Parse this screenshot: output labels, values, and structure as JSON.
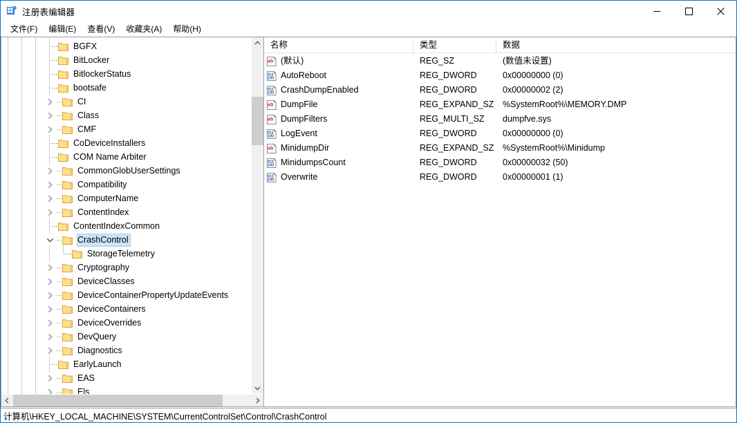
{
  "window": {
    "title": "注册表编辑器",
    "icon": "regedit-icon",
    "border_color": "#0078d7",
    "controls": [
      {
        "name": "minimize-button",
        "glyph": "minimize-icon"
      },
      {
        "name": "maximize-button",
        "glyph": "maximize-icon"
      },
      {
        "name": "close-button",
        "glyph": "close-icon"
      }
    ]
  },
  "menubar": {
    "items": [
      {
        "label": "文件(F)"
      },
      {
        "label": "编辑(E)"
      },
      {
        "label": "查看(V)"
      },
      {
        "label": "收藏夹(A)"
      },
      {
        "label": "帮助(H)"
      }
    ]
  },
  "tree": {
    "selected_key": "CrashControl",
    "selection_color": "#cce4f7",
    "folder_color": "#ffd966",
    "nodes": [
      {
        "label": "BGFX",
        "depth": 0,
        "expander": "none",
        "connector": "tee"
      },
      {
        "label": "BitLocker",
        "depth": 0,
        "expander": "none",
        "connector": "tee"
      },
      {
        "label": "BitlockerStatus",
        "depth": 0,
        "expander": "none",
        "connector": "tee"
      },
      {
        "label": "bootsafe",
        "depth": 0,
        "expander": "none",
        "connector": "tee"
      },
      {
        "label": "CI",
        "depth": 0,
        "expander": "collapsed",
        "connector": "tee"
      },
      {
        "label": "Class",
        "depth": 0,
        "expander": "collapsed",
        "connector": "tee"
      },
      {
        "label": "CMF",
        "depth": 0,
        "expander": "collapsed",
        "connector": "tee"
      },
      {
        "label": "CoDeviceInstallers",
        "depth": 0,
        "expander": "none",
        "connector": "tee"
      },
      {
        "label": "COM Name Arbiter",
        "depth": 0,
        "expander": "none",
        "connector": "tee"
      },
      {
        "label": "CommonGlobUserSettings",
        "depth": 0,
        "expander": "collapsed",
        "connector": "tee"
      },
      {
        "label": "Compatibility",
        "depth": 0,
        "expander": "collapsed",
        "connector": "tee"
      },
      {
        "label": "ComputerName",
        "depth": 0,
        "expander": "collapsed",
        "connector": "tee"
      },
      {
        "label": "ContentIndex",
        "depth": 0,
        "expander": "collapsed",
        "connector": "tee"
      },
      {
        "label": "ContentIndexCommon",
        "depth": 0,
        "expander": "none",
        "connector": "tee"
      },
      {
        "label": "CrashControl",
        "depth": 0,
        "expander": "expanded",
        "connector": "tee",
        "selected": true
      },
      {
        "label": "StorageTelemetry",
        "depth": 1,
        "expander": "none",
        "connector": "last"
      },
      {
        "label": "Cryptography",
        "depth": 0,
        "expander": "collapsed",
        "connector": "tee"
      },
      {
        "label": "DeviceClasses",
        "depth": 0,
        "expander": "collapsed",
        "connector": "tee"
      },
      {
        "label": "DeviceContainerPropertyUpdateEvents",
        "depth": 0,
        "expander": "collapsed",
        "connector": "tee"
      },
      {
        "label": "DeviceContainers",
        "depth": 0,
        "expander": "collapsed",
        "connector": "tee"
      },
      {
        "label": "DeviceOverrides",
        "depth": 0,
        "expander": "collapsed",
        "connector": "tee"
      },
      {
        "label": "DevQuery",
        "depth": 0,
        "expander": "collapsed",
        "connector": "tee"
      },
      {
        "label": "Diagnostics",
        "depth": 0,
        "expander": "collapsed",
        "connector": "tee"
      },
      {
        "label": "EarlyLaunch",
        "depth": 0,
        "expander": "none",
        "connector": "tee"
      },
      {
        "label": "EAS",
        "depth": 0,
        "expander": "collapsed",
        "connector": "tee"
      },
      {
        "label": "Els",
        "depth": 0,
        "expander": "collapsed",
        "connector": "tee"
      }
    ]
  },
  "list": {
    "columns": [
      {
        "label": "名称"
      },
      {
        "label": "类型"
      },
      {
        "label": "数据"
      }
    ],
    "rows": [
      {
        "icon": "string-value-icon",
        "name": "(默认)",
        "type": "REG_SZ",
        "data": "(数值未设置)"
      },
      {
        "icon": "dword-value-icon",
        "name": "AutoReboot",
        "type": "REG_DWORD",
        "data": "0x00000000 (0)"
      },
      {
        "icon": "dword-value-icon",
        "name": "CrashDumpEnabled",
        "type": "REG_DWORD",
        "data": "0x00000002 (2)"
      },
      {
        "icon": "string-value-icon",
        "name": "DumpFile",
        "type": "REG_EXPAND_SZ",
        "data": "%SystemRoot%\\MEMORY.DMP"
      },
      {
        "icon": "string-value-icon",
        "name": "DumpFilters",
        "type": "REG_MULTI_SZ",
        "data": "dumpfve.sys"
      },
      {
        "icon": "dword-value-icon",
        "name": "LogEvent",
        "type": "REG_DWORD",
        "data": "0x00000000 (0)"
      },
      {
        "icon": "string-value-icon",
        "name": "MinidumpDir",
        "type": "REG_EXPAND_SZ",
        "data": "%SystemRoot%\\Minidump"
      },
      {
        "icon": "dword-value-icon",
        "name": "MinidumpsCount",
        "type": "REG_DWORD",
        "data": "0x00000032 (50)"
      },
      {
        "icon": "dword-value-icon",
        "name": "Overwrite",
        "type": "REG_DWORD",
        "data": "0x00000001 (1)"
      }
    ]
  },
  "statusbar": {
    "path": "计算机\\HKEY_LOCAL_MACHINE\\SYSTEM\\CurrentControlSet\\Control\\CrashControl"
  }
}
